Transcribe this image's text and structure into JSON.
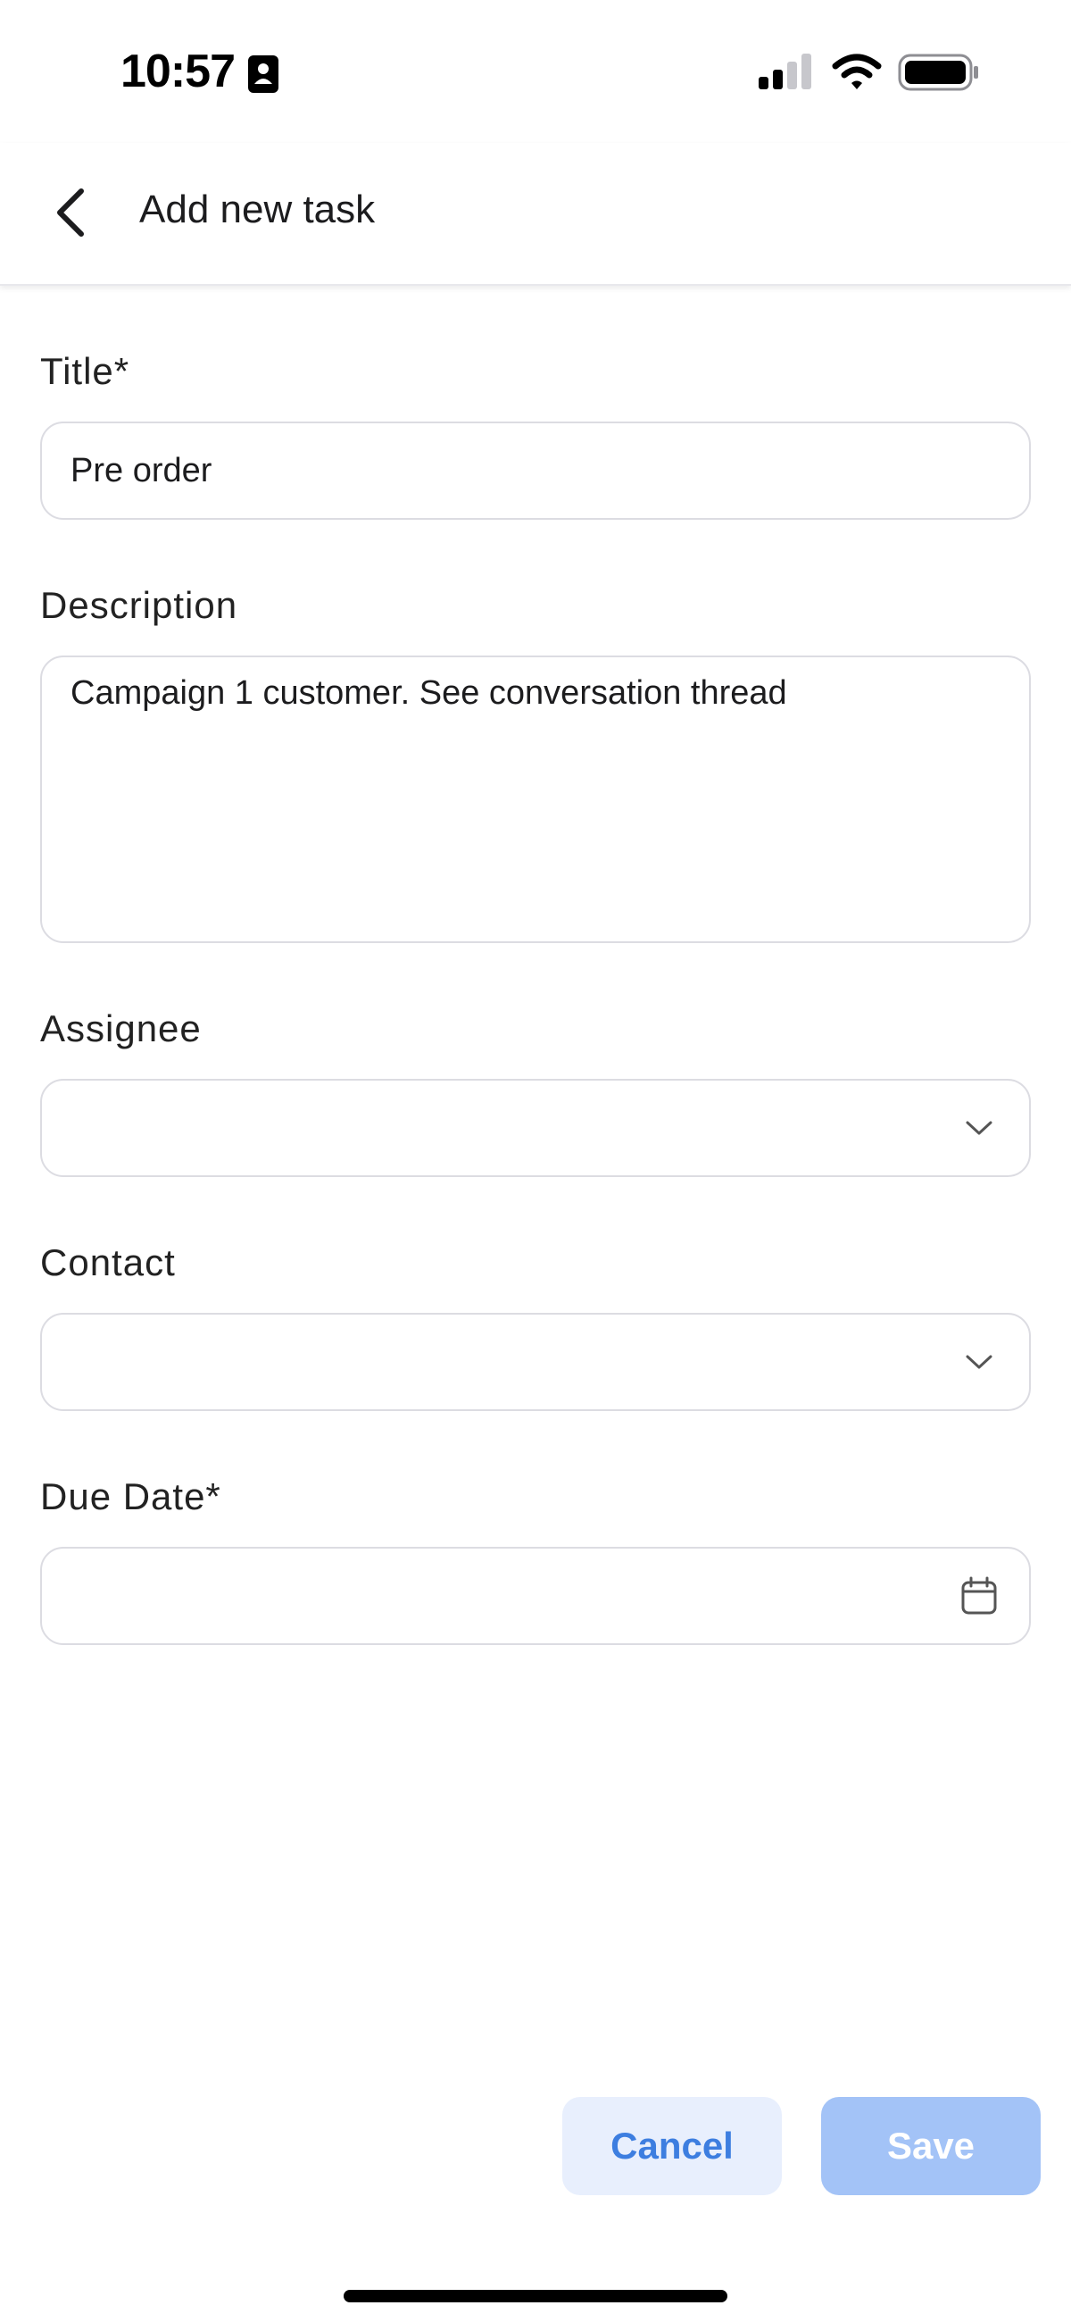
{
  "status_bar": {
    "time": "10:57",
    "icons": [
      "contact-card-icon",
      "signal-icon",
      "wifi-icon",
      "battery-icon"
    ]
  },
  "header": {
    "title": "Add new task",
    "back_icon": "chevron-left-icon"
  },
  "form": {
    "title": {
      "label": "Title*",
      "value": "Pre order"
    },
    "description": {
      "label": "Description",
      "value": "Campaign 1 customer. See conversation thread"
    },
    "assignee": {
      "label": "Assignee",
      "value": "",
      "icon": "chevron-down-icon"
    },
    "contact": {
      "label": "Contact",
      "value": "",
      "icon": "chevron-down-icon"
    },
    "due_date": {
      "label": "Due Date*",
      "value": "",
      "icon": "calendar-icon"
    }
  },
  "footer": {
    "cancel_label": "Cancel",
    "save_label": "Save"
  },
  "colors": {
    "accent": "#3d7ee0",
    "cancel_bg": "#e8effd",
    "save_bg_disabled": "#a3c3f7",
    "field_border": "#dcdce2"
  }
}
